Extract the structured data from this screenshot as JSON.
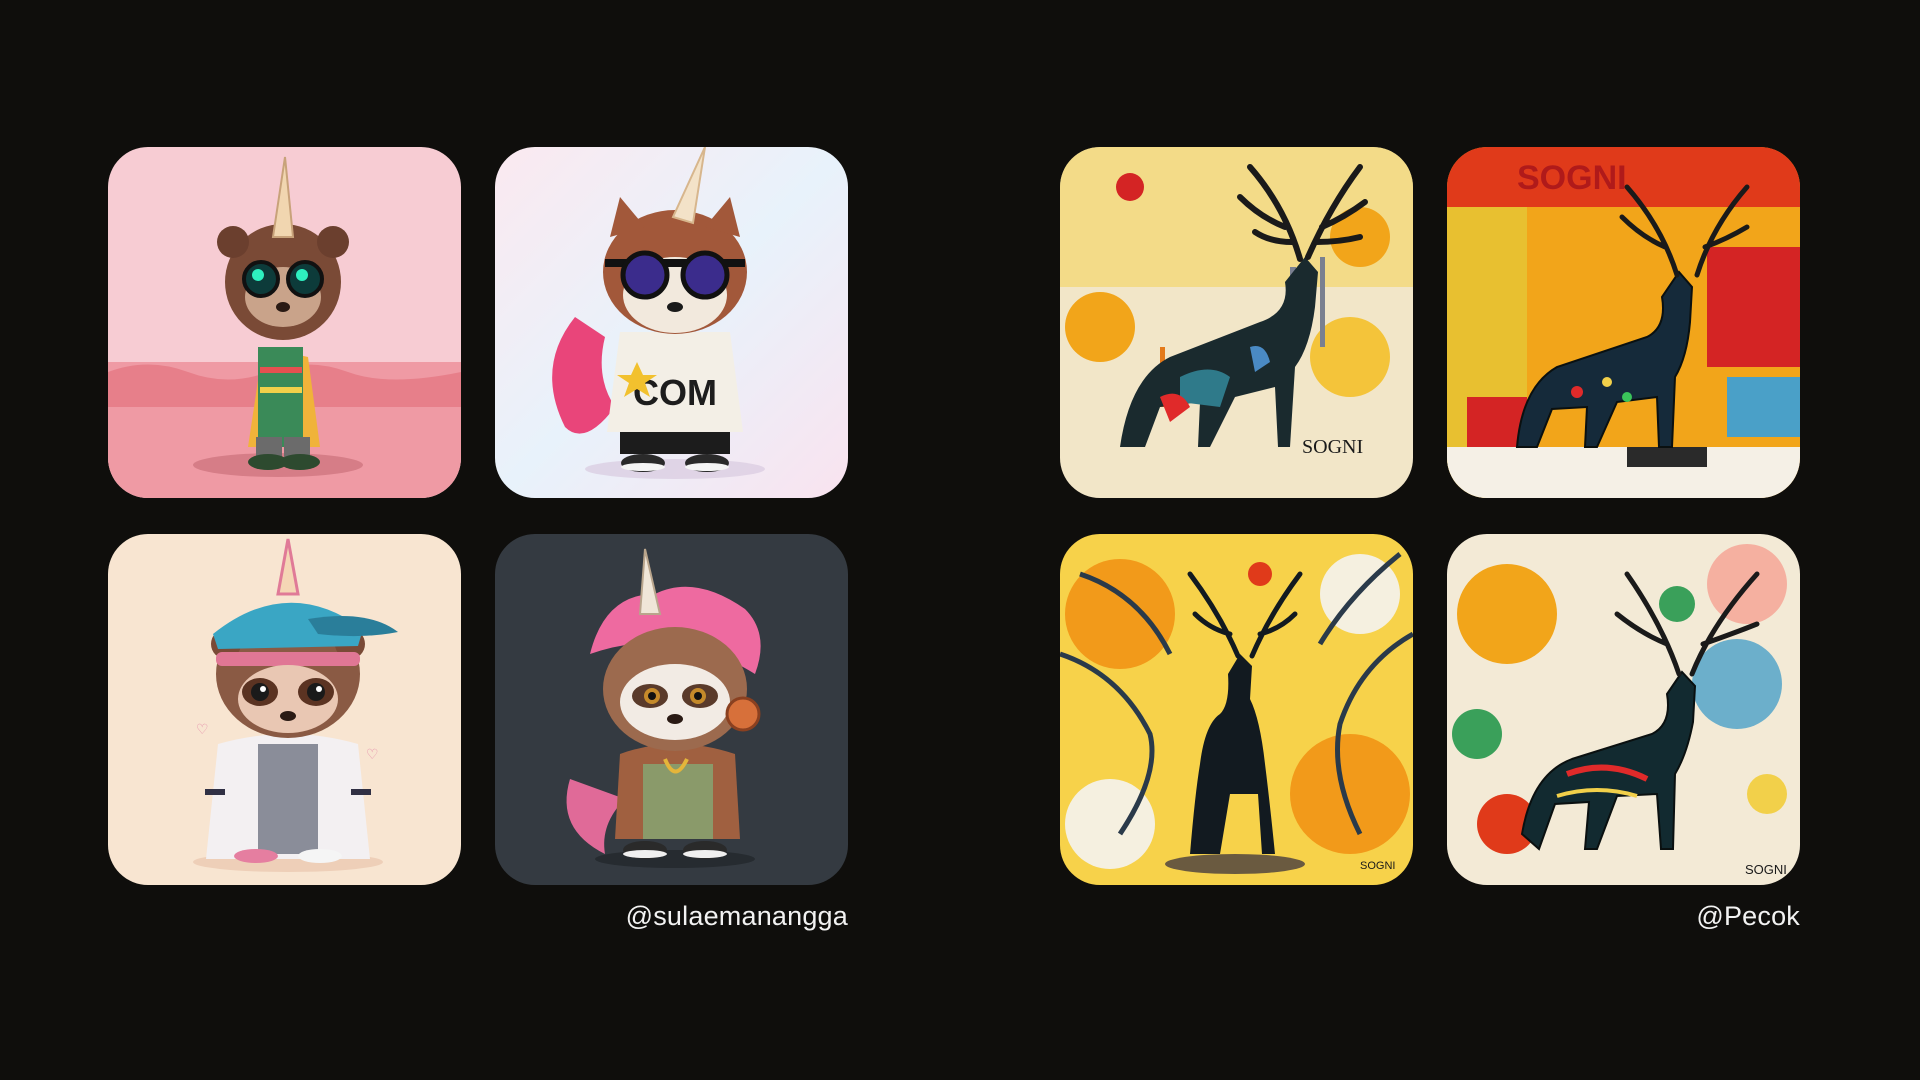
{
  "groups": [
    {
      "credit": "@sulaemanangga",
      "tiles": [
        {
          "name": "sloth-unicorn-yellow-jacket",
          "bg": "#f6c9cf"
        },
        {
          "name": "raccoon-unicorn-com-jacket",
          "bg": "#f5e8f1",
          "shirt_text": "COM"
        },
        {
          "name": "sloth-unicorn-cap-hoodie",
          "bg": "#f7e4cf"
        },
        {
          "name": "sloth-unicorn-headphones",
          "bg": "#343a41"
        }
      ]
    },
    {
      "credit": "@Pecok",
      "tiles": [
        {
          "name": "deer-abstract-drips",
          "bg": "#f4d35e",
          "signature": "SOGNI"
        },
        {
          "name": "deer-abstract-graffiti",
          "bg": "#f2a51a",
          "signature": "SOGNI"
        },
        {
          "name": "deer-abstract-branches",
          "bg": "#f6c21f",
          "signature": "SOGNI"
        },
        {
          "name": "deer-abstract-splatter",
          "bg": "#f3ead6",
          "signature": "SOGNI"
        }
      ]
    }
  ]
}
